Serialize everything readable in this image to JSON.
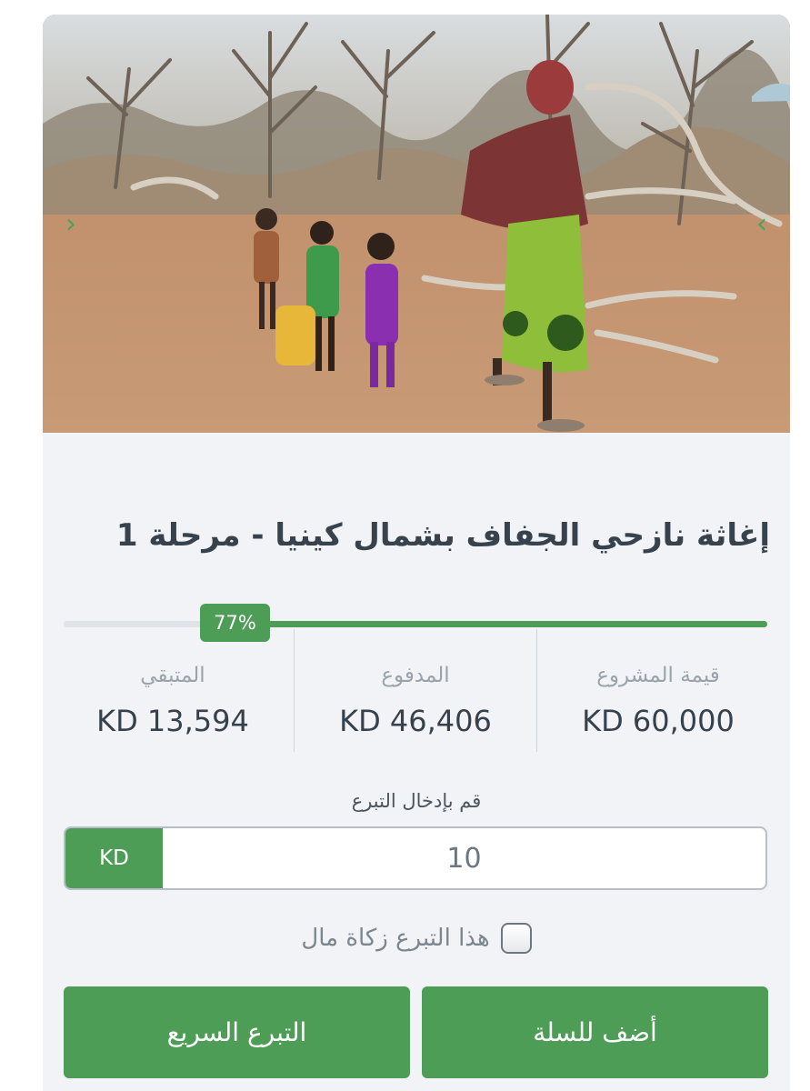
{
  "hero": {
    "prev_icon": "chevron-left-icon",
    "next_icon": "chevron-right-icon",
    "prev_glyph": "›",
    "next_glyph": "‹"
  },
  "project": {
    "title": "إغاثة نازحي الجفاف بشمال كينيا - مرحلة 1",
    "progress_percent": 77,
    "progress_label": "77%"
  },
  "stats": [
    {
      "label": "قيمة المشروع",
      "value": "KD 60,000"
    },
    {
      "label": "المدفوع",
      "value": "KD 46,406"
    },
    {
      "label": "المتبقي",
      "value": "KD 13,594"
    }
  ],
  "donation": {
    "label": "قم بإدخال التبرع",
    "currency": "KD",
    "amount": "10",
    "zakat_label": "هذا التبرع زكاة مال",
    "zakat_checked": false
  },
  "buttons": {
    "add_to_cart": "أضف للسلة",
    "quick_donate": "التبرع السريع"
  },
  "colors": {
    "accent": "#4e9d57",
    "card_bg": "#f1f3f6"
  }
}
